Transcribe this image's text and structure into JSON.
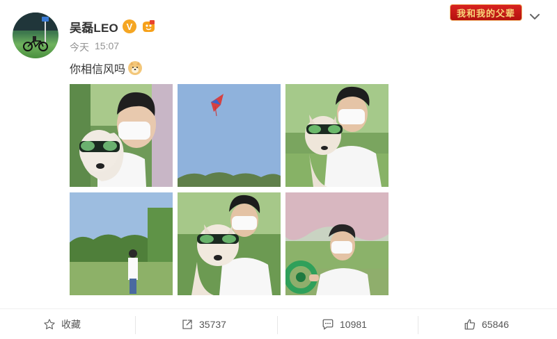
{
  "post": {
    "username": "吴磊LEO",
    "verified_badge": "V",
    "time_prefix": "今天",
    "time": "15:07",
    "text": "你相信风吗",
    "promo_text": "我和我的父辈",
    "icons": {
      "verified": "verified-v-icon",
      "level": "level-badge-icon",
      "emoji": "doge-emoji-icon",
      "more": "chevron-down-icon"
    },
    "photos": [
      {
        "name": "photo-man-with-dog-1"
      },
      {
        "name": "photo-kite-sky"
      },
      {
        "name": "photo-man-with-dog-2"
      },
      {
        "name": "photo-man-in-field"
      },
      {
        "name": "photo-man-with-dog-3"
      },
      {
        "name": "photo-man-with-kite-reel"
      }
    ]
  },
  "actions": {
    "favorite_label": "收藏",
    "repost_count": "35737",
    "comment_count": "10981",
    "like_count": "65846"
  },
  "colors": {
    "text_primary": "#333333",
    "text_secondary": "#939393",
    "verified": "#f5a623",
    "promo_red": "#c8191a"
  }
}
